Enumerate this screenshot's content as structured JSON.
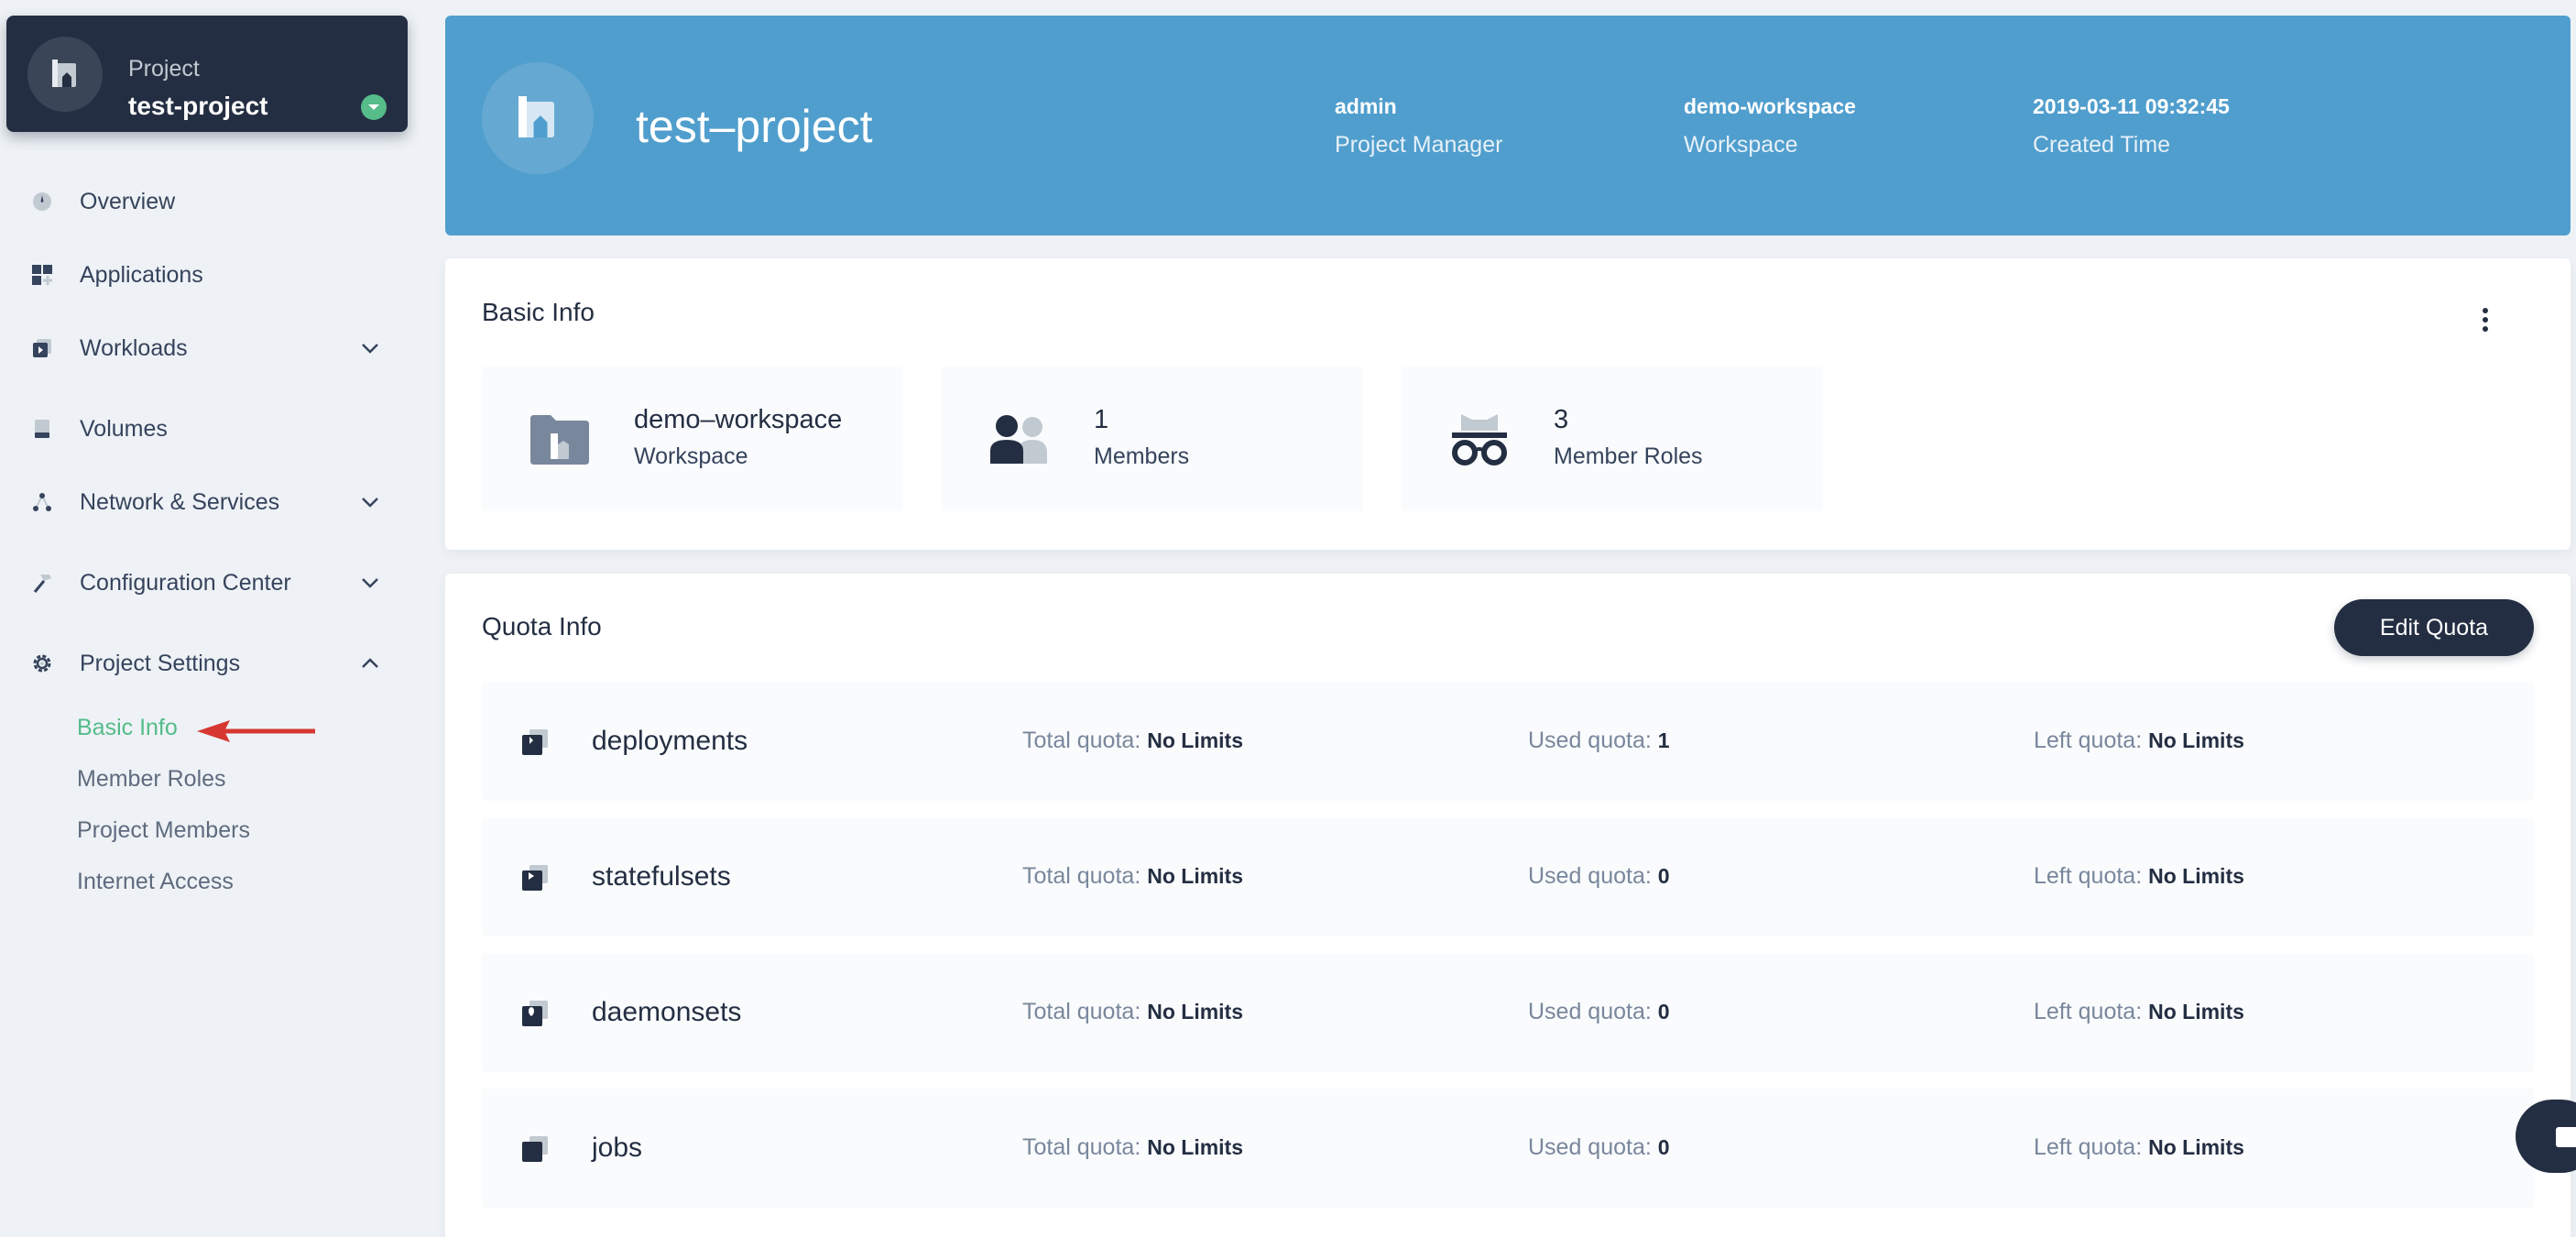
{
  "sidebar": {
    "project_label": "Project",
    "project_name": "test-project",
    "nav": [
      {
        "label": "Overview"
      },
      {
        "label": "Applications"
      },
      {
        "label": "Workloads"
      },
      {
        "label": "Volumes"
      },
      {
        "label": "Network & Services"
      },
      {
        "label": "Configuration Center"
      },
      {
        "label": "Project Settings"
      }
    ],
    "sub": [
      {
        "label": "Basic Info"
      },
      {
        "label": "Member Roles"
      },
      {
        "label": "Project Members"
      },
      {
        "label": "Internet Access"
      }
    ]
  },
  "banner": {
    "title": "test–project",
    "meta": [
      {
        "value": "admin",
        "label": "Project Manager"
      },
      {
        "value": "demo-workspace",
        "label": "Workspace"
      },
      {
        "value": "2019-03-11 09:32:45",
        "label": "Created Time"
      }
    ]
  },
  "basic_info": {
    "title": "Basic Info",
    "boxes": [
      {
        "value": "demo–workspace",
        "label": "Workspace"
      },
      {
        "value": "1",
        "label": "Members"
      },
      {
        "value": "3",
        "label": "Member Roles"
      }
    ]
  },
  "quota": {
    "title": "Quota Info",
    "edit_label": "Edit Quota",
    "total_label": "Total quota:",
    "used_label": "Used quota:",
    "left_label": "Left quota:",
    "rows": [
      {
        "name": "deployments",
        "total": "No Limits",
        "used": "1",
        "left": "No Limits"
      },
      {
        "name": "statefulsets",
        "total": "No Limits",
        "used": "0",
        "left": "No Limits"
      },
      {
        "name": "daemonsets",
        "total": "No Limits",
        "used": "0",
        "left": "No Limits"
      },
      {
        "name": "jobs",
        "total": "No Limits",
        "used": "0",
        "left": "No Limits"
      }
    ]
  },
  "colors": {
    "brand_dark": "#242e42",
    "banner_blue": "#509ecd",
    "active_green": "#55bc8a",
    "annotation_red": "#d63831"
  }
}
